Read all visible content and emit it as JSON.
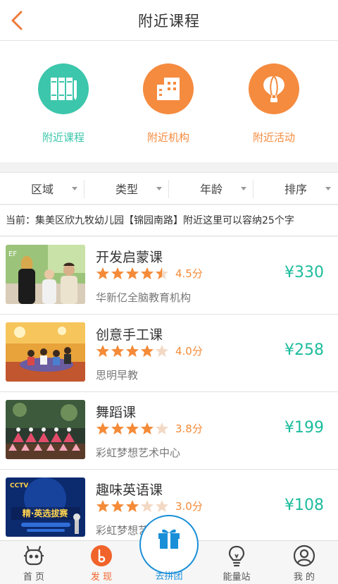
{
  "header": {
    "title": "附近课程"
  },
  "categories": [
    {
      "label": "附近课程",
      "icon": "books-icon",
      "color": "#3cc6ab"
    },
    {
      "label": "附近机构",
      "icon": "building-icon",
      "color": "#f58b3f"
    },
    {
      "label": "附近活动",
      "icon": "balloon-icon",
      "color": "#f58b3f"
    }
  ],
  "filters": [
    "区域",
    "类型",
    "年龄",
    "排序"
  ],
  "location": "当前：集美区欣九牧幼儿园【锦园南路】附近这里可以容纳25个字",
  "courses": [
    {
      "name": "开发启蒙课",
      "rating": 4.5,
      "score": "4.5分",
      "org": "华新亿全脑教育机构",
      "price": "¥330"
    },
    {
      "name": "创意手工课",
      "rating": 4.0,
      "score": "4.0分",
      "org": "思明早教",
      "price": "¥258"
    },
    {
      "name": "舞蹈课",
      "rating": 3.8,
      "score": "3.8分",
      "org": "彩虹梦想艺术中心",
      "price": "¥199"
    },
    {
      "name": "趣味英语课",
      "rating": 3.0,
      "score": "3.0分",
      "org": "彩虹梦想艺术中心",
      "price": "¥108"
    }
  ],
  "thumb_text": {
    "ef": "EF",
    "cctv": "CCTV",
    "contest": "精·英选拔赛"
  },
  "tabs": [
    {
      "label": "首 页",
      "icon": "robot-icon"
    },
    {
      "label": "发 现",
      "icon": "discover-icon",
      "active": true
    },
    {
      "label": "去拼团",
      "icon": "gift-icon"
    },
    {
      "label": "能量站",
      "icon": "bulb-icon"
    },
    {
      "label": "我 的",
      "icon": "user-icon"
    }
  ],
  "colors": {
    "accent_orange": "#f58b38",
    "accent_teal": "#1cbc9c",
    "accent_blue": "#1a8fd8",
    "star": "#f58b38"
  }
}
